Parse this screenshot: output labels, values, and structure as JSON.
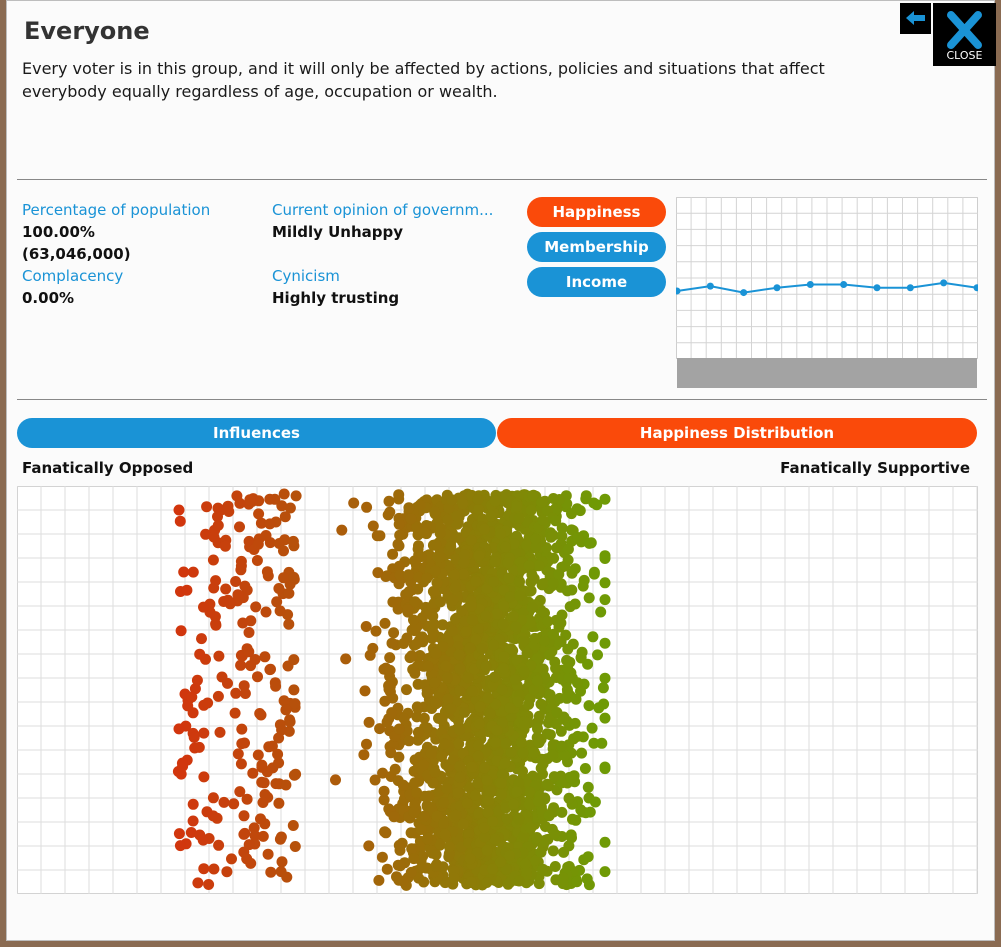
{
  "title": "Everyone",
  "description": "Every voter is in this group, and it will only be affected by actions, policies and situations that affect everybody equally regardless of age, occupation or wealth.",
  "close_label": "CLOSE",
  "stats": {
    "percentage_label": "Percentage of population",
    "percentage_value": "100.00%",
    "percentage_count": "(63,046,000)",
    "complacency_label": "Complacency",
    "complacency_value": "0.00%",
    "opinion_label": "Current opinion of governm...",
    "opinion_value": "Mildly Unhappy",
    "cynicism_label": "Cynicism",
    "cynicism_value": "Highly trusting"
  },
  "graph_buttons": [
    "Happiness",
    "Membership",
    "Income"
  ],
  "happiness_trend": [
    0.42,
    0.45,
    0.41,
    0.44,
    0.46,
    0.46,
    0.44,
    0.44,
    0.47,
    0.44
  ],
  "tabs": {
    "influences": "Influences",
    "distribution": "Happiness Distribution"
  },
  "axis": {
    "left": "Fanatically Opposed",
    "right": "Fanatically Supportive"
  },
  "colors": {
    "accent_red": "#fa4a0a",
    "accent_blue": "#1a93d6",
    "opposed": "#d2350d",
    "supportive": "#6f9a05"
  }
}
